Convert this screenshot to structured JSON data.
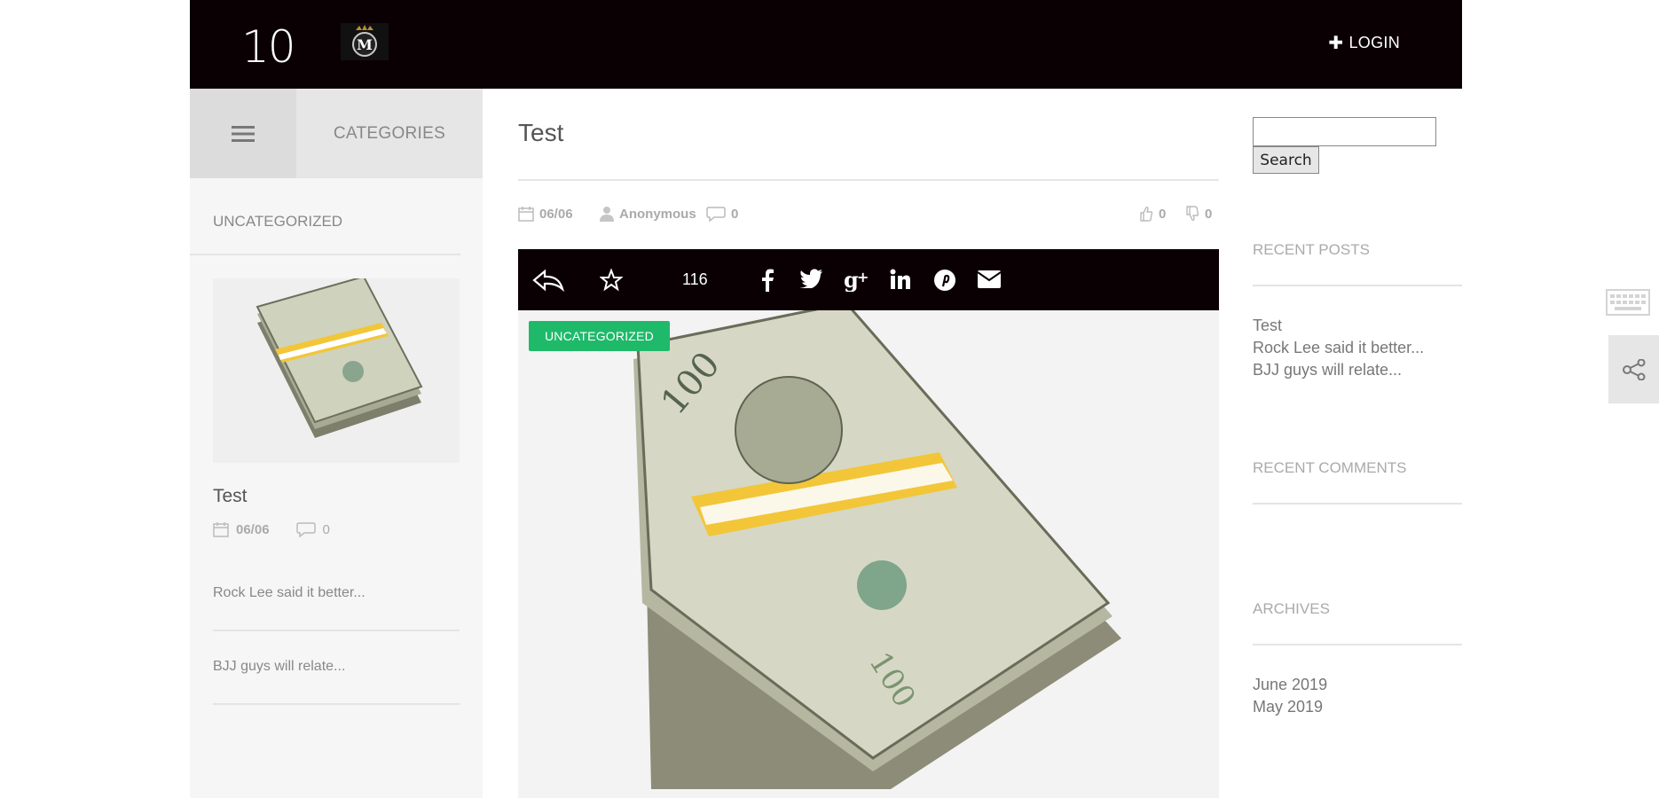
{
  "header": {
    "logo_text": "10",
    "crest_letter": "M",
    "login_label": "LOGIN"
  },
  "left_sidebar": {
    "categories_label": "CATEGORIES",
    "section_title": "UNCATEGORIZED",
    "featured_post": {
      "title": "Test",
      "date": "06/06",
      "comments": "0"
    },
    "links": [
      "Rock Lee said it better...",
      "BJJ guys will relate..."
    ]
  },
  "post": {
    "title": "Test",
    "date": "06/06",
    "author": "Anonymous",
    "comments": "0",
    "likes": "0",
    "dislikes": "0",
    "share_count": "116",
    "category_badge": "UNCATEGORIZED"
  },
  "right_sidebar": {
    "search_button": "Search",
    "recent_posts_title": "RECENT POSTS",
    "recent_posts": [
      "Test",
      "Rock Lee said it better...",
      "BJJ guys will relate..."
    ],
    "recent_comments_title": "RECENT COMMENTS",
    "archives_title": "ARCHIVES",
    "archives": [
      "June 2019",
      "May 2019"
    ]
  },
  "colors": {
    "topbar": "#0a0003",
    "badge": "#1fb96a",
    "sidebar_bg": "#f6f6f6"
  }
}
